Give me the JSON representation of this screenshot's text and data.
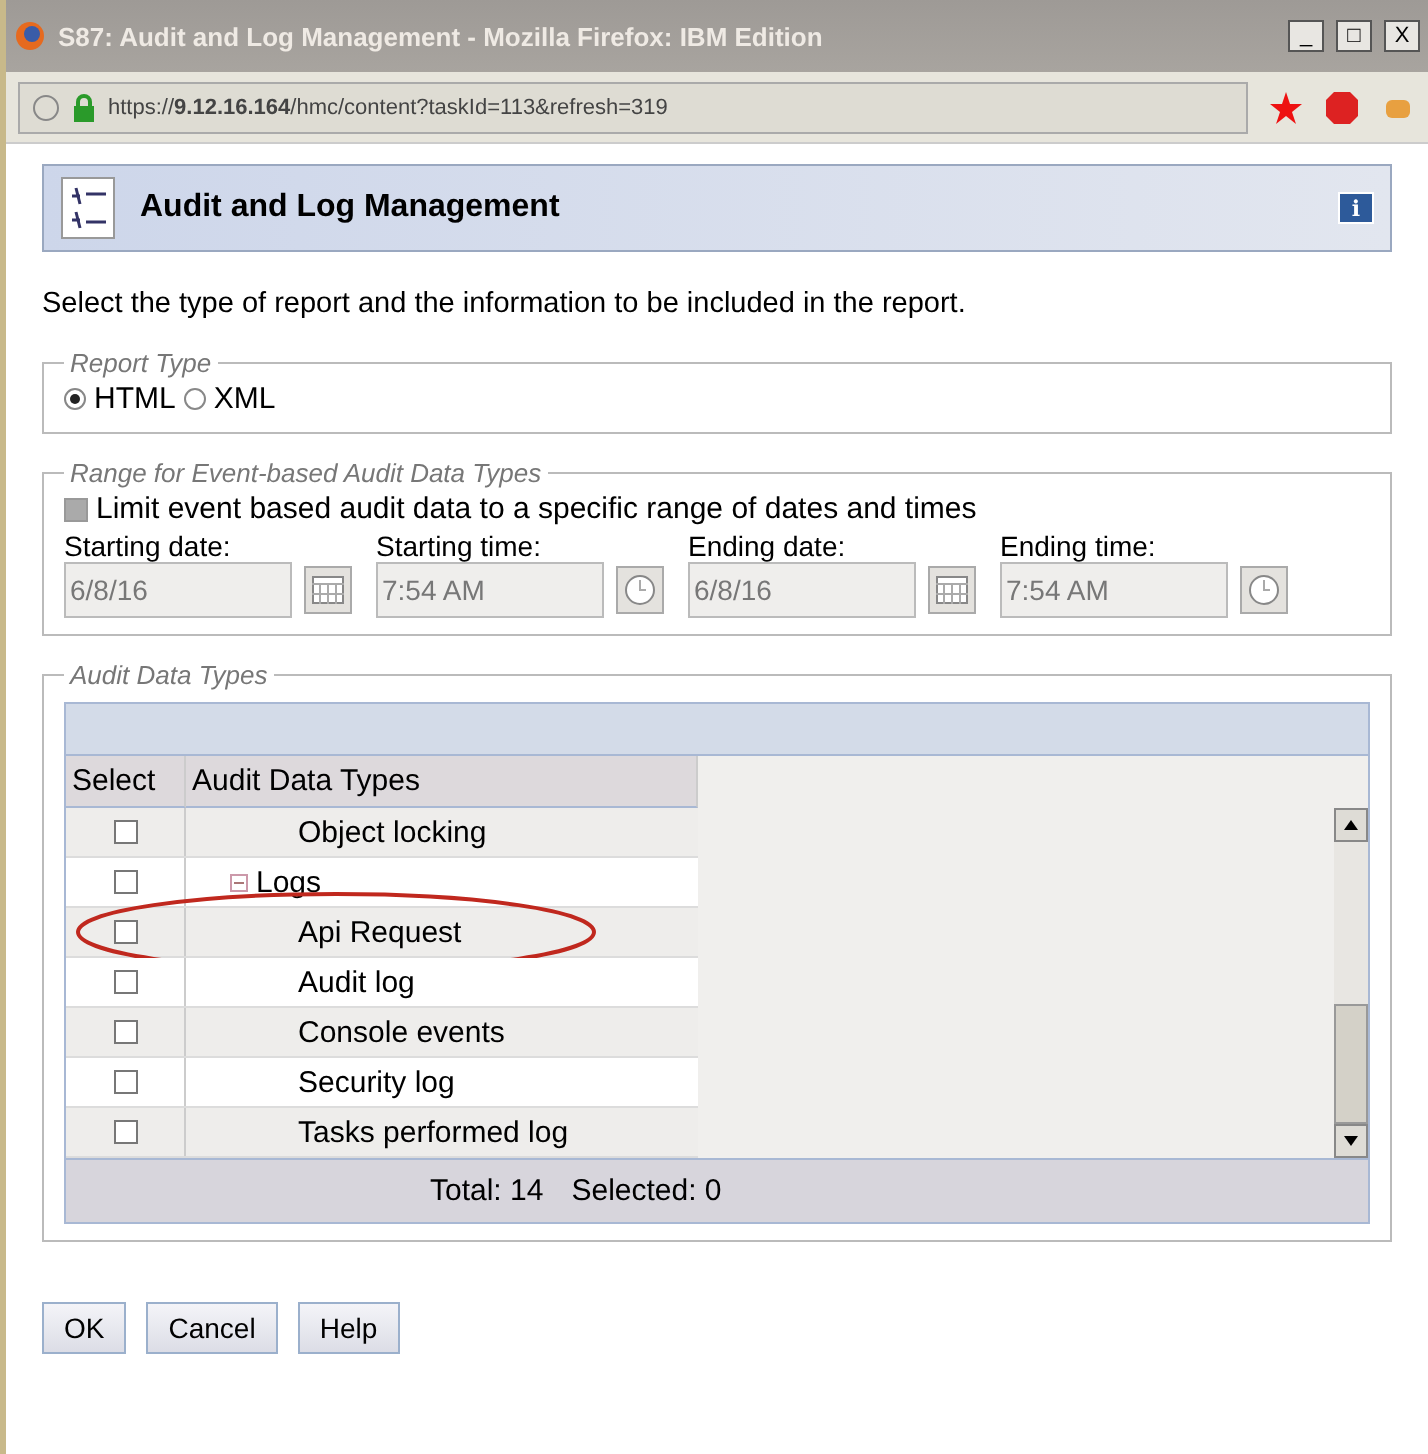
{
  "window": {
    "title": "S87: Audit and Log Management - Mozilla Firefox: IBM Edition",
    "controls": [
      "_",
      "□",
      "X"
    ]
  },
  "address_bar": {
    "url_start": "https://",
    "url_host": "9.12.16.164",
    "url_rest": "/hmc/content?taskId=113&refresh=319"
  },
  "panel": {
    "title": "Audit and Log Management",
    "info_glyph": "i"
  },
  "intro": "Select the type of report and the information to be included in the report.",
  "report_type": {
    "legend": "Report Type",
    "options": [
      {
        "label": "HTML",
        "selected": true
      },
      {
        "label": "XML",
        "selected": false
      }
    ]
  },
  "range": {
    "legend": "Range for Event-based Audit Data Types",
    "limit": {
      "label": "Limit event based audit data to a specific range of dates and times",
      "checked": false,
      "disabled": true
    },
    "fields": [
      {
        "label": "Starting date:",
        "value": "6/8/16",
        "kind": "date",
        "disabled": true
      },
      {
        "label": "Starting time:",
        "value": "7:54 AM",
        "kind": "time",
        "disabled": true
      },
      {
        "label": "Ending date:",
        "value": "6/8/16",
        "kind": "date",
        "disabled": true
      },
      {
        "label": "Ending time:",
        "value": "7:54 AM",
        "kind": "time",
        "disabled": true
      }
    ]
  },
  "audit_types": {
    "legend": "Audit Data Types",
    "columns": [
      "Select",
      "Audit Data Types"
    ],
    "rows": [
      {
        "label": "Object locking",
        "checked": false
      },
      {
        "label": "Logs",
        "checked": false,
        "expanded": true,
        "children": [
          {
            "label": "Api Request",
            "checked": false,
            "circled": true
          },
          {
            "label": "Audit log",
            "checked": false
          },
          {
            "label": "Console events",
            "checked": false
          },
          {
            "label": "Security log",
            "checked": false
          },
          {
            "label": "Tasks performed log",
            "checked": false
          }
        ]
      }
    ],
    "footer": {
      "total": "Total: 14",
      "selected": "Selected: 0"
    }
  },
  "buttons": [
    "OK",
    "Cancel",
    "Help"
  ]
}
